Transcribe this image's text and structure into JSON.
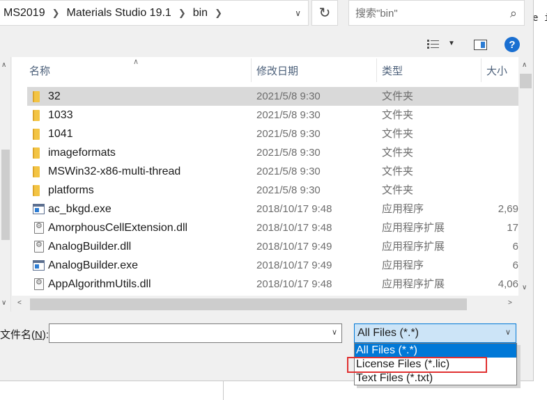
{
  "address": {
    "crumbs": [
      "MS2019",
      "Materials Studio 19.1",
      "bin"
    ]
  },
  "search": {
    "placeholder": "搜索\"bin\""
  },
  "background_text": "e i",
  "columns": {
    "name": "名称",
    "date": "修改日期",
    "type": "类型",
    "size": "大小"
  },
  "files": [
    {
      "name": "32",
      "date": "2021/5/8 9:30",
      "type": "文件夹",
      "size": "",
      "icon": "folder-icon",
      "selected": true
    },
    {
      "name": "1033",
      "date": "2021/5/8 9:30",
      "type": "文件夹",
      "size": "",
      "icon": "folder-icon"
    },
    {
      "name": "1041",
      "date": "2021/5/8 9:30",
      "type": "文件夹",
      "size": "",
      "icon": "folder-icon"
    },
    {
      "name": "imageformats",
      "date": "2021/5/8 9:30",
      "type": "文件夹",
      "size": "",
      "icon": "folder-icon"
    },
    {
      "name": "MSWin32-x86-multi-thread",
      "date": "2021/5/8 9:30",
      "type": "文件夹",
      "size": "",
      "icon": "folder-icon"
    },
    {
      "name": "platforms",
      "date": "2021/5/8 9:30",
      "type": "文件夹",
      "size": "",
      "icon": "folder-icon"
    },
    {
      "name": "ac_bkgd.exe",
      "date": "2018/10/17 9:48",
      "type": "应用程序",
      "size": "2,69",
      "icon": "exe-icon"
    },
    {
      "name": "AmorphousCellExtension.dll",
      "date": "2018/10/17 9:48",
      "type": "应用程序扩展",
      "size": "17",
      "icon": "dll-icon"
    },
    {
      "name": "AnalogBuilder.dll",
      "date": "2018/10/17 9:49",
      "type": "应用程序扩展",
      "size": "6",
      "icon": "dll-icon"
    },
    {
      "name": "AnalogBuilder.exe",
      "date": "2018/10/17 9:49",
      "type": "应用程序",
      "size": "6",
      "icon": "exe-icon"
    },
    {
      "name": "AppAlgorithmUtils.dll",
      "date": "2018/10/17 9:48",
      "type": "应用程序扩展",
      "size": "4,06",
      "icon": "dll-icon"
    }
  ],
  "filename": {
    "label_prefix": "文件名(",
    "label_key": "N",
    "label_suffix": "):",
    "value": ""
  },
  "filter": {
    "selected": "All Files (*.*)",
    "options": [
      "All Files (*.*)",
      "License Files (*.lic)",
      "Text Files (*.txt)"
    ],
    "highlighted_index": 0
  },
  "colors": {
    "accent": "#0078d7",
    "annotation": "#e03030"
  }
}
